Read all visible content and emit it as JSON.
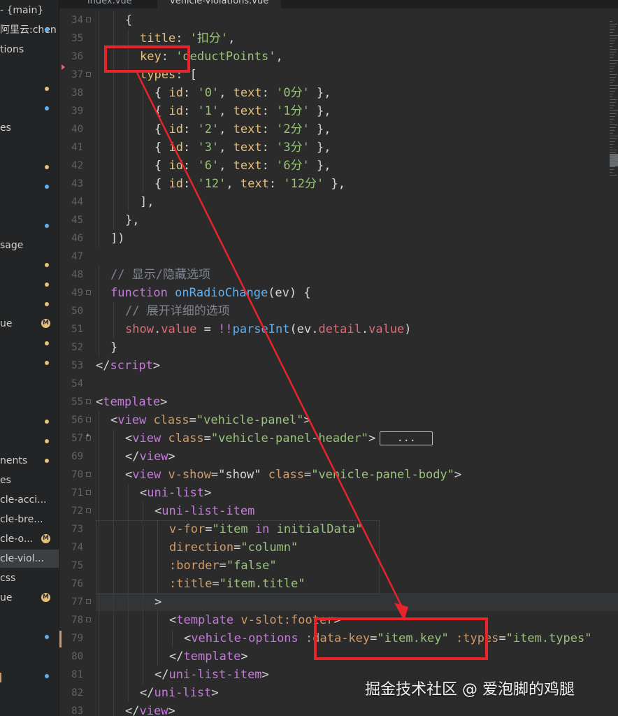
{
  "tabs": [
    {
      "label": "index.vue"
    },
    {
      "label": "vehicle-violations.vue",
      "active": true
    }
  ],
  "sidebar": {
    "items": [
      {
        "label": "- {main}",
        "marker": ""
      },
      {
        "label": "阿里云:chen",
        "marker": "blue"
      },
      {
        "label": "tions",
        "marker": ""
      },
      {
        "label": "",
        "marker": ""
      },
      {
        "label": "",
        "marker": "yellow"
      },
      {
        "label": "",
        "marker": "blue"
      },
      {
        "label": "es",
        "marker": ""
      },
      {
        "label": "",
        "marker": ""
      },
      {
        "label": "",
        "marker": "yellow"
      },
      {
        "label": "",
        "marker": "blue"
      },
      {
        "label": "",
        "marker": ""
      },
      {
        "label": "",
        "marker": "blue"
      },
      {
        "label": "sage",
        "marker": ""
      },
      {
        "label": "",
        "marker": "yellow"
      },
      {
        "label": "",
        "marker": "yellow"
      },
      {
        "label": "",
        "marker": "yellow"
      },
      {
        "label": "ue",
        "marker": "M"
      },
      {
        "label": "",
        "marker": "yellow"
      },
      {
        "label": "",
        "marker": "yellow"
      },
      {
        "label": "",
        "marker": ""
      },
      {
        "label": "",
        "marker": ""
      },
      {
        "label": "",
        "marker": "yellow"
      },
      {
        "label": "",
        "marker": "yellow"
      },
      {
        "label": "nents",
        "marker": "yellow"
      },
      {
        "label": "es",
        "marker": ""
      },
      {
        "label": "cle-acci...",
        "marker": ""
      },
      {
        "label": "cle-bre...",
        "marker": ""
      },
      {
        "label": "cle-o...",
        "marker": "M"
      },
      {
        "label": "cle-viol...",
        "marker": "",
        "selected": true
      },
      {
        "label": "css",
        "marker": ""
      },
      {
        "label": "ue",
        "marker": "M"
      },
      {
        "label": "",
        "marker": ""
      },
      {
        "label": "",
        "marker": "blue"
      },
      {
        "label": "",
        "marker": ""
      },
      {
        "label": "",
        "marker": "blue"
      },
      {
        "label": "",
        "marker": ""
      },
      {
        "label": "",
        "marker": ""
      },
      {
        "label": "",
        "marker": ""
      }
    ],
    "badge_text": "M"
  },
  "code": {
    "lines": [
      {
        "num": "34",
        "fold": "minus",
        "indent": 2,
        "tokens": [
          {
            "t": "{",
            "c": "punc"
          }
        ]
      },
      {
        "num": "35",
        "indent": 3,
        "tokens": [
          {
            "t": "title",
            "c": "key"
          },
          {
            "t": ": ",
            "c": "punc"
          },
          {
            "t": "'扣分'",
            "c": "str"
          },
          {
            "t": ",",
            "c": "punc"
          }
        ]
      },
      {
        "num": "36",
        "indent": 3,
        "tokens": [
          {
            "t": "key",
            "c": "key"
          },
          {
            "t": ": ",
            "c": "punc"
          },
          {
            "t": "'deductPoints'",
            "c": "str"
          },
          {
            "t": ",",
            "c": "punc"
          }
        ]
      },
      {
        "num": "37",
        "fold": "minus",
        "indent": 3,
        "tokens": [
          {
            "t": "types",
            "c": "key"
          },
          {
            "t": ": [",
            "c": "punc"
          }
        ]
      },
      {
        "num": "38",
        "indent": 4,
        "tokens": [
          {
            "t": "{ ",
            "c": "punc"
          },
          {
            "t": "id",
            "c": "key"
          },
          {
            "t": ": ",
            "c": "punc"
          },
          {
            "t": "'0'",
            "c": "str"
          },
          {
            "t": ", ",
            "c": "punc"
          },
          {
            "t": "text",
            "c": "key"
          },
          {
            "t": ": ",
            "c": "punc"
          },
          {
            "t": "'0分'",
            "c": "str"
          },
          {
            "t": " },",
            "c": "punc"
          }
        ]
      },
      {
        "num": "39",
        "indent": 4,
        "tokens": [
          {
            "t": "{ ",
            "c": "punc"
          },
          {
            "t": "id",
            "c": "key"
          },
          {
            "t": ": ",
            "c": "punc"
          },
          {
            "t": "'1'",
            "c": "str"
          },
          {
            "t": ", ",
            "c": "punc"
          },
          {
            "t": "text",
            "c": "key"
          },
          {
            "t": ": ",
            "c": "punc"
          },
          {
            "t": "'1分'",
            "c": "str"
          },
          {
            "t": " },",
            "c": "punc"
          }
        ]
      },
      {
        "num": "40",
        "indent": 4,
        "tokens": [
          {
            "t": "{ ",
            "c": "punc"
          },
          {
            "t": "id",
            "c": "key"
          },
          {
            "t": ": ",
            "c": "punc"
          },
          {
            "t": "'2'",
            "c": "str"
          },
          {
            "t": ", ",
            "c": "punc"
          },
          {
            "t": "text",
            "c": "key"
          },
          {
            "t": ": ",
            "c": "punc"
          },
          {
            "t": "'2分'",
            "c": "str"
          },
          {
            "t": " },",
            "c": "punc"
          }
        ]
      },
      {
        "num": "41",
        "indent": 4,
        "tokens": [
          {
            "t": "{ ",
            "c": "punc"
          },
          {
            "t": "id",
            "c": "key"
          },
          {
            "t": ": ",
            "c": "punc"
          },
          {
            "t": "'3'",
            "c": "str"
          },
          {
            "t": ", ",
            "c": "punc"
          },
          {
            "t": "text",
            "c": "key"
          },
          {
            "t": ": ",
            "c": "punc"
          },
          {
            "t": "'3分'",
            "c": "str"
          },
          {
            "t": " },",
            "c": "punc"
          }
        ]
      },
      {
        "num": "42",
        "indent": 4,
        "tokens": [
          {
            "t": "{ ",
            "c": "punc"
          },
          {
            "t": "id",
            "c": "key"
          },
          {
            "t": ": ",
            "c": "punc"
          },
          {
            "t": "'6'",
            "c": "str"
          },
          {
            "t": ", ",
            "c": "punc"
          },
          {
            "t": "text",
            "c": "key"
          },
          {
            "t": ": ",
            "c": "punc"
          },
          {
            "t": "'6分'",
            "c": "str"
          },
          {
            "t": " },",
            "c": "punc"
          }
        ]
      },
      {
        "num": "43",
        "indent": 4,
        "tokens": [
          {
            "t": "{ ",
            "c": "punc"
          },
          {
            "t": "id",
            "c": "key"
          },
          {
            "t": ": ",
            "c": "punc"
          },
          {
            "t": "'12'",
            "c": "str"
          },
          {
            "t": ", ",
            "c": "punc"
          },
          {
            "t": "text",
            "c": "key"
          },
          {
            "t": ": ",
            "c": "punc"
          },
          {
            "t": "'12分'",
            "c": "str"
          },
          {
            "t": " },",
            "c": "punc"
          }
        ]
      },
      {
        "num": "44",
        "indent": 3,
        "tokens": [
          {
            "t": "],",
            "c": "punc"
          }
        ]
      },
      {
        "num": "45",
        "indent": 2,
        "tokens": [
          {
            "t": "},",
            "c": "punc"
          }
        ]
      },
      {
        "num": "46",
        "indent": 1,
        "tokens": [
          {
            "t": "])",
            "c": "punc"
          }
        ]
      },
      {
        "num": "47",
        "indent": 0,
        "tokens": []
      },
      {
        "num": "48",
        "indent": 1,
        "tokens": [
          {
            "t": "// 显示/隐藏选项",
            "c": "com"
          }
        ]
      },
      {
        "num": "49",
        "fold": "minus",
        "indent": 1,
        "tokens": [
          {
            "t": "function ",
            "c": "kw"
          },
          {
            "t": "onRadioChange",
            "c": "fn"
          },
          {
            "t": "(ev) {",
            "c": "punc"
          }
        ]
      },
      {
        "num": "50",
        "indent": 2,
        "tokens": [
          {
            "t": "// 展开详细的选项",
            "c": "com"
          }
        ]
      },
      {
        "num": "51",
        "indent": 2,
        "tokens": [
          {
            "t": "show",
            "c": "prop"
          },
          {
            "t": ".",
            "c": "punc"
          },
          {
            "t": "value",
            "c": "prop"
          },
          {
            "t": " = ",
            "c": "punc"
          },
          {
            "t": "!!",
            "c": "kw"
          },
          {
            "t": "parseInt",
            "c": "fn"
          },
          {
            "t": "(ev.",
            "c": "punc"
          },
          {
            "t": "detail",
            "c": "prop"
          },
          {
            "t": ".",
            "c": "punc"
          },
          {
            "t": "value",
            "c": "prop"
          },
          {
            "t": ")",
            "c": "punc"
          }
        ]
      },
      {
        "num": "52",
        "indent": 1,
        "tokens": [
          {
            "t": "}",
            "c": "punc"
          }
        ]
      },
      {
        "num": "53",
        "indent": 0,
        "tokens": [
          {
            "t": "</",
            "c": "punc"
          },
          {
            "t": "script",
            "c": "tag"
          },
          {
            "t": ">",
            "c": "punc"
          }
        ]
      },
      {
        "num": "54",
        "indent": 0,
        "tokens": []
      },
      {
        "num": "55",
        "fold": "minus",
        "indent": 0,
        "tokens": [
          {
            "t": "<",
            "c": "punc"
          },
          {
            "t": "template",
            "c": "tag"
          },
          {
            "t": ">",
            "c": "punc"
          }
        ]
      },
      {
        "num": "56",
        "fold": "minus",
        "indent": 1,
        "tokens": [
          {
            "t": "<",
            "c": "punc"
          },
          {
            "t": "view ",
            "c": "tag"
          },
          {
            "t": "class",
            "c": "attr"
          },
          {
            "t": "=",
            "c": "punc"
          },
          {
            "t": "\"vehicle-panel\"",
            "c": "str"
          },
          {
            "t": ">",
            "c": "punc"
          }
        ]
      },
      {
        "num": "57",
        "fold": "plus",
        "indent": 2,
        "ellipsis": true,
        "tokens": [
          {
            "t": "<",
            "c": "punc"
          },
          {
            "t": "view ",
            "c": "tag"
          },
          {
            "t": "class",
            "c": "attr"
          },
          {
            "t": "=",
            "c": "punc"
          },
          {
            "t": "\"vehicle-panel-header\"",
            "c": "str"
          },
          {
            "t": ">",
            "c": "punc"
          }
        ]
      },
      {
        "num": "69",
        "indent": 2,
        "tokens": [
          {
            "t": "</",
            "c": "punc"
          },
          {
            "t": "view",
            "c": "tag"
          },
          {
            "t": ">",
            "c": "punc"
          }
        ]
      },
      {
        "num": "70",
        "fold": "minus",
        "indent": 2,
        "tokens": [
          {
            "t": "<",
            "c": "punc"
          },
          {
            "t": "view ",
            "c": "tag"
          },
          {
            "t": "v-show",
            "c": "attr"
          },
          {
            "t": "=",
            "c": "punc"
          },
          {
            "t": "\"show\" ",
            "c": "punc"
          },
          {
            "t": "class",
            "c": "attr"
          },
          {
            "t": "=",
            "c": "punc"
          },
          {
            "t": "\"vehicle-panel-body\"",
            "c": "str"
          },
          {
            "t": ">",
            "c": "punc"
          }
        ]
      },
      {
        "num": "71",
        "fold": "minus",
        "indent": 3,
        "tokens": [
          {
            "t": "<",
            "c": "punc"
          },
          {
            "t": "uni-list",
            "c": "tag"
          },
          {
            "t": ">",
            "c": "punc"
          }
        ]
      },
      {
        "num": "72",
        "fold": "minus",
        "indent": 4,
        "tokens": [
          {
            "t": "<",
            "c": "punc"
          },
          {
            "t": "uni-list-item",
            "c": "tag"
          }
        ]
      },
      {
        "num": "73",
        "indent": 5,
        "tokens": [
          {
            "t": "v-for",
            "c": "attr"
          },
          {
            "t": "=",
            "c": "punc"
          },
          {
            "t": "\"item ",
            "c": "str"
          },
          {
            "t": "in",
            "c": "kw"
          },
          {
            "t": " initialData\"",
            "c": "str"
          }
        ]
      },
      {
        "num": "74",
        "indent": 5,
        "tokens": [
          {
            "t": "direction",
            "c": "attr"
          },
          {
            "t": "=",
            "c": "punc"
          },
          {
            "t": "\"column\"",
            "c": "str"
          }
        ]
      },
      {
        "num": "75",
        "indent": 5,
        "tokens": [
          {
            "t": ":border",
            "c": "attr"
          },
          {
            "t": "=",
            "c": "punc"
          },
          {
            "t": "\"false\"",
            "c": "str"
          }
        ]
      },
      {
        "num": "76",
        "indent": 5,
        "tokens": [
          {
            "t": ":title",
            "c": "attr"
          },
          {
            "t": "=",
            "c": "punc"
          },
          {
            "t": "\"item.title\"",
            "c": "str"
          }
        ]
      },
      {
        "num": "77",
        "fold": "minus",
        "indent": 4,
        "tokens": [
          {
            "t": ">",
            "c": "punc"
          }
        ]
      },
      {
        "num": "78",
        "fold": "minus",
        "indent": 5,
        "tokens": [
          {
            "t": "<",
            "c": "punc"
          },
          {
            "t": "template ",
            "c": "tag"
          },
          {
            "t": "v-slot:footer",
            "c": "attr"
          },
          {
            "t": ">",
            "c": "punc"
          }
        ]
      },
      {
        "num": "79",
        "indent": 6,
        "tokens": [
          {
            "t": "<",
            "c": "punc"
          },
          {
            "t": "vehicle-options ",
            "c": "tag"
          },
          {
            "t": ":data-key",
            "c": "attr"
          },
          {
            "t": "=",
            "c": "punc"
          },
          {
            "t": "\"item.key\" ",
            "c": "str"
          },
          {
            "t": ":types",
            "c": "attr"
          },
          {
            "t": "=",
            "c": "punc"
          },
          {
            "t": "\"item.types\"",
            "c": "str"
          }
        ]
      },
      {
        "num": "80",
        "indent": 5,
        "tokens": [
          {
            "t": "</",
            "c": "punc"
          },
          {
            "t": "template",
            "c": "tag"
          },
          {
            "t": ">",
            "c": "punc"
          }
        ]
      },
      {
        "num": "81",
        "indent": 4,
        "tokens": [
          {
            "t": "</",
            "c": "punc"
          },
          {
            "t": "uni-list-item",
            "c": "tag"
          },
          {
            "t": ">",
            "c": "punc"
          }
        ]
      },
      {
        "num": "82",
        "indent": 3,
        "tokens": [
          {
            "t": "</",
            "c": "punc"
          },
          {
            "t": "uni-list",
            "c": "tag"
          },
          {
            "t": ">",
            "c": "punc"
          }
        ]
      },
      {
        "num": "83",
        "indent": 2,
        "tokens": [
          {
            "t": "</",
            "c": "punc"
          },
          {
            "t": "view",
            "c": "tag"
          },
          {
            "t": ">",
            "c": "punc"
          }
        ]
      }
    ],
    "ellipsis_label": "..."
  },
  "watermark": "掘金技术社区 @ 爱泡脚的鸡腿",
  "colors": {
    "background": "#2b2b2b",
    "annotation": "#e8232a",
    "keyword": "#c678dd",
    "property_key": "#e5c07b",
    "string": "#98c379",
    "function": "#61afef",
    "comment": "#7f848e",
    "attribute": "#d19a66"
  }
}
